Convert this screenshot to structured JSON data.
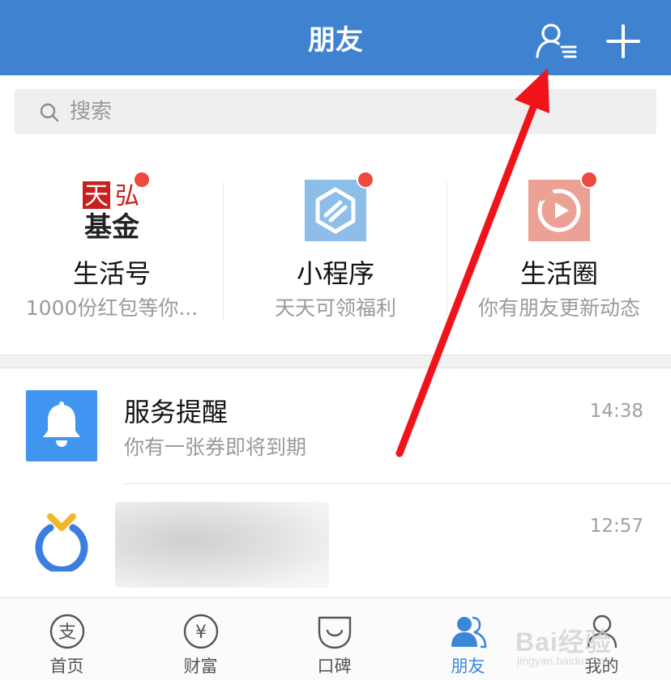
{
  "header": {
    "title": "朋友"
  },
  "search": {
    "placeholder": "搜索"
  },
  "quick_items": [
    {
      "title": "生活号",
      "subtitle": "1000份红包等你...",
      "logo_line1_a": "天",
      "logo_line1_b": "弘",
      "logo_line2": "基金"
    },
    {
      "title": "小程序",
      "subtitle": "天天可领福利"
    },
    {
      "title": "生活圈",
      "subtitle": "你有朋友更新动态"
    }
  ],
  "messages": [
    {
      "title": "服务提醒",
      "subtitle": "你有一张券即将到期",
      "time": "14:38"
    },
    {
      "title": "",
      "subtitle": "",
      "time": "12:57"
    }
  ],
  "tabs": [
    {
      "label": "首页",
      "glyph": "支"
    },
    {
      "label": "财富",
      "glyph": "¥"
    },
    {
      "label": "口碑"
    },
    {
      "label": "朋友",
      "active": true
    },
    {
      "label": "我的"
    }
  ],
  "watermark": {
    "text": "Bai经验",
    "sub": "jingyan.baidu.com"
  },
  "colors": {
    "header": "#3f83d0",
    "accent": "#3c86d8",
    "badge": "#ec4a3d",
    "arrow": "#f0141a"
  }
}
